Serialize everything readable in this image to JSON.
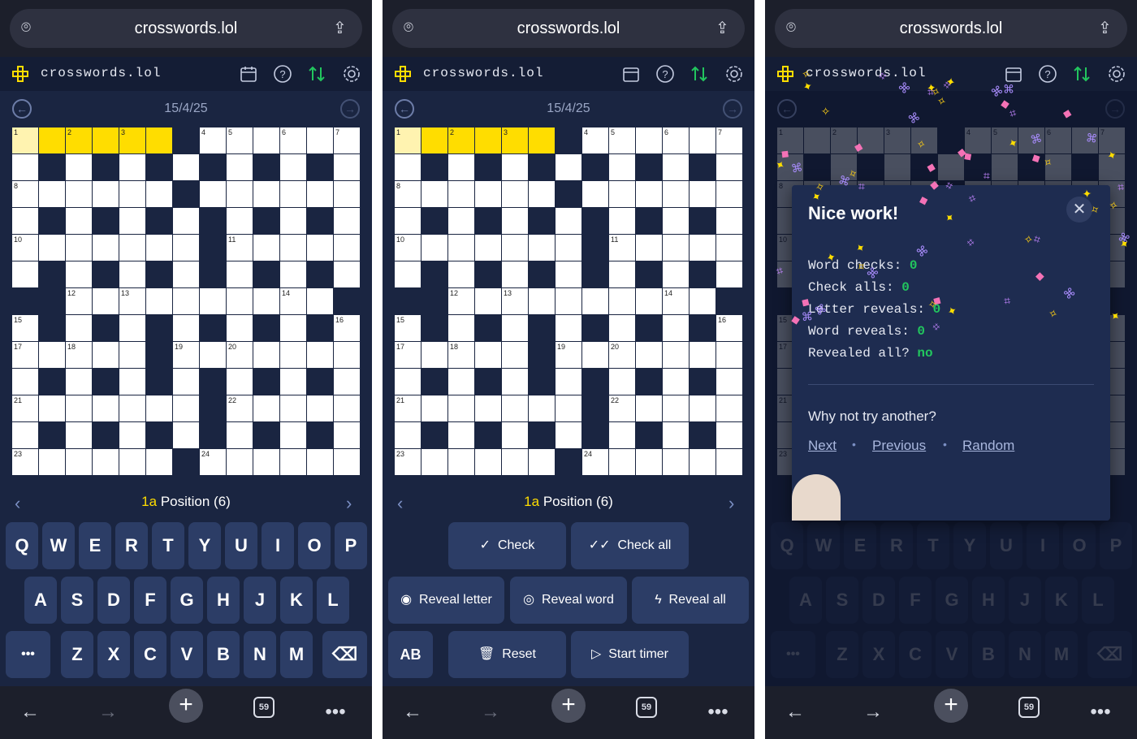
{
  "url": "crosswords.lol",
  "app": {
    "logo_text": "crosswords.lol"
  },
  "date": "15/4/25",
  "clue": {
    "number": "1a",
    "text": "Position (6)"
  },
  "keyboard": {
    "row1": [
      "Q",
      "W",
      "E",
      "R",
      "T",
      "Y",
      "U",
      "I",
      "O",
      "P"
    ],
    "row2": [
      "A",
      "S",
      "D",
      "F",
      "G",
      "H",
      "J",
      "K",
      "L"
    ],
    "row3": [
      "Z",
      "X",
      "C",
      "V",
      "B",
      "N",
      "M"
    ],
    "more_label": "•••"
  },
  "actions": {
    "check": "Check",
    "check_all": "Check all",
    "reveal_letter": "Reveal letter",
    "reveal_word": "Reveal word",
    "reveal_all": "Reveal all",
    "ab": "AB",
    "reset": "Reset",
    "start_timer": "Start timer"
  },
  "tabs_count": "59",
  "modal": {
    "title": "Nice work!",
    "stats": [
      {
        "label": "Word checks: ",
        "value": "0"
      },
      {
        "label": "Check alls: ",
        "value": "0"
      },
      {
        "label": "Letter reveals: ",
        "value": "0"
      },
      {
        "label": "Word reveals: ",
        "value": "0"
      },
      {
        "label": "Revealed all? ",
        "value": "no"
      }
    ],
    "question": "Why not try another?",
    "next": "Next",
    "previous": "Previous",
    "random": "Random"
  },
  "colors": {
    "accent": "#ffdd00",
    "bg": "#1a2541",
    "success": "#22c55e"
  }
}
